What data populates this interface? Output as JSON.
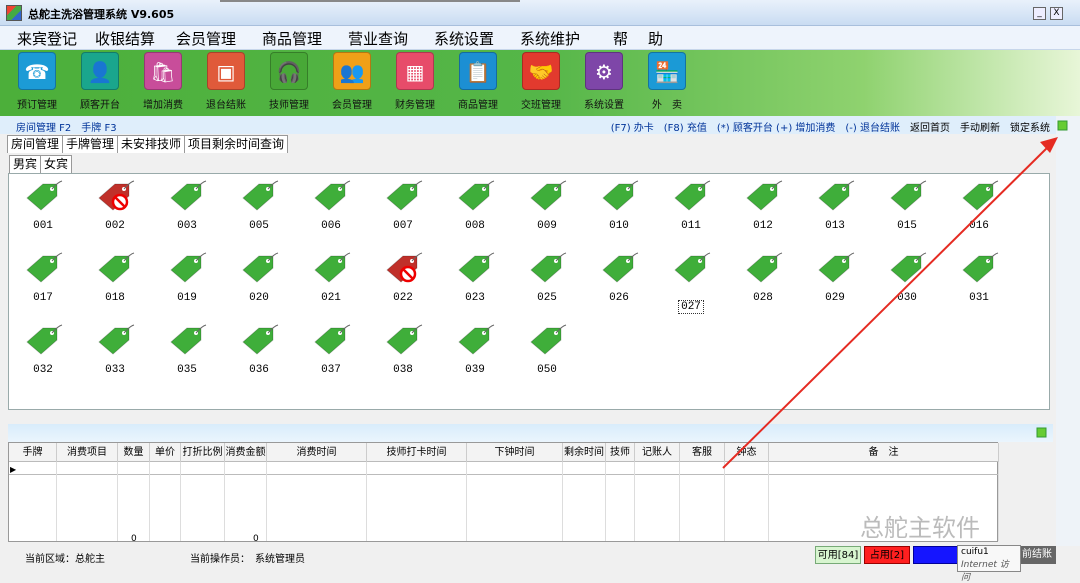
{
  "window": {
    "title": "总舵主洗浴管理系统 V9.605",
    "min": "_",
    "close": "X"
  },
  "menu": [
    "来宾登记",
    "收银结算",
    "会员管理",
    "商品管理",
    "营业查询",
    "系统设置",
    "系统维护",
    "帮",
    "助"
  ],
  "toolbar": [
    {
      "label": "预订管理",
      "icon": "phone-icon",
      "color": "#1c9bd6"
    },
    {
      "label": "顾客开台",
      "icon": "user-add-icon",
      "color": "#1aa68d"
    },
    {
      "label": "增加消费",
      "icon": "bag-icon",
      "color": "#c84d9a"
    },
    {
      "label": "退台结账",
      "icon": "wallet-icon",
      "color": "#e05a3a"
    },
    {
      "label": "技师管理",
      "icon": "headset-icon",
      "color": "#48a837"
    },
    {
      "label": "会员管理",
      "icon": "group-icon",
      "color": "#f0a018"
    },
    {
      "label": "财务管理",
      "icon": "calculator-icon",
      "color": "#e74c6a"
    },
    {
      "label": "商品管理",
      "icon": "clipboard-icon",
      "color": "#1c8fd3"
    },
    {
      "label": "交班管理",
      "icon": "handshake-icon",
      "color": "#e23a2e"
    },
    {
      "label": "系统设置",
      "icon": "gear-icon",
      "color": "#7e46a8"
    },
    {
      "label": "外　卖",
      "icon": "shop-icon",
      "color": "#1b9ad6"
    }
  ],
  "subbar": {
    "left": "房间管理 F2　手牌 F3",
    "right": "(F7) 办卡　(F8) 充值　(*) 顾客开台 (+) 增加消费　(-) 退台结账",
    "right2": "返回首页　手动刷新　锁定系统"
  },
  "tabs1": [
    "房间管理",
    "手牌管理",
    "未安排技师",
    "项目剩余时间查询"
  ],
  "tabs2": [
    "男宾",
    "女宾"
  ],
  "tags": [
    {
      "num": "001",
      "status": "free"
    },
    {
      "num": "002",
      "status": "occupied"
    },
    {
      "num": "003",
      "status": "free"
    },
    {
      "num": "005",
      "status": "free"
    },
    {
      "num": "006",
      "status": "free"
    },
    {
      "num": "007",
      "status": "free"
    },
    {
      "num": "008",
      "status": "free"
    },
    {
      "num": "009",
      "status": "free"
    },
    {
      "num": "010",
      "status": "free"
    },
    {
      "num": "011",
      "status": "free"
    },
    {
      "num": "012",
      "status": "free"
    },
    {
      "num": "013",
      "status": "free"
    },
    {
      "num": "015",
      "status": "free"
    },
    {
      "num": "016",
      "status": "free"
    },
    {
      "num": "017",
      "status": "free"
    },
    {
      "num": "018",
      "status": "free"
    },
    {
      "num": "019",
      "status": "free"
    },
    {
      "num": "020",
      "status": "free"
    },
    {
      "num": "021",
      "status": "free"
    },
    {
      "num": "022",
      "status": "occupied"
    },
    {
      "num": "023",
      "status": "free"
    },
    {
      "num": "025",
      "status": "free"
    },
    {
      "num": "026",
      "status": "free"
    },
    {
      "num": "027",
      "status": "free",
      "selected": true
    },
    {
      "num": "028",
      "status": "free"
    },
    {
      "num": "029",
      "status": "free"
    },
    {
      "num": "030",
      "status": "free"
    },
    {
      "num": "031",
      "status": "free"
    },
    {
      "num": "032",
      "status": "free"
    },
    {
      "num": "033",
      "status": "free"
    },
    {
      "num": "035",
      "status": "free"
    },
    {
      "num": "036",
      "status": "free"
    },
    {
      "num": "037",
      "status": "free"
    },
    {
      "num": "038",
      "status": "free"
    },
    {
      "num": "039",
      "status": "free"
    },
    {
      "num": "050",
      "status": "free"
    }
  ],
  "table": {
    "headers": [
      "手牌",
      "消费项目",
      "数量",
      "单价",
      "打折比例",
      "消费金额",
      "消费时间",
      "技师打卡时间",
      "下钟时间",
      "剩余时间",
      "技师",
      "记账人",
      "客服",
      "钟态",
      "备　注"
    ],
    "sum_qty": "0",
    "sum_amount": "0"
  },
  "status": {
    "area": "当前区域：总舵主",
    "operator": "当前操作员：　系统管理员",
    "available": "可用[84]",
    "occupied": "占用[2]",
    "other": "",
    "settle": "前结账"
  },
  "tooltip": {
    "user": "cuifu1",
    "text": "Internet 访问"
  },
  "watermark": "总舵主软件",
  "colors": {
    "free": "#3fae3a",
    "occupied": "#c0302a",
    "available_bg": "#d8f5d0",
    "occupied_bg": "#ff1f1f",
    "blue_bg": "#1515ff"
  }
}
